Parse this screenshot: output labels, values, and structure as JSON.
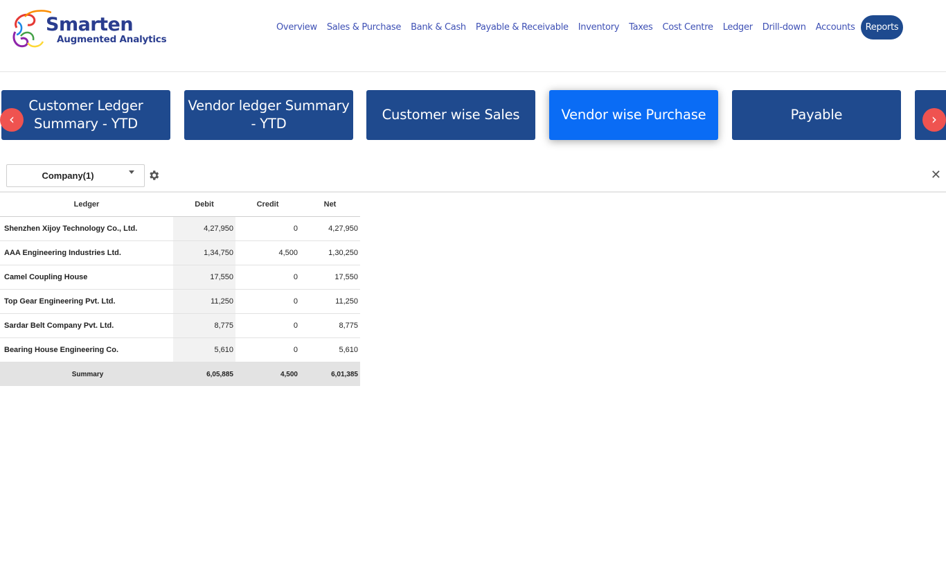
{
  "logo": {
    "title": "Smarten",
    "subtitle": "Augmented Analytics"
  },
  "nav": {
    "items": [
      "Overview",
      "Sales & Purchase",
      "Bank & Cash",
      "Payable & Receivable",
      "Inventory",
      "Taxes",
      "Cost Centre",
      "Ledger",
      "Drill-down",
      "Accounts"
    ],
    "active": "Reports"
  },
  "carousel": {
    "cards": [
      "Customer Ledger Summary - YTD",
      "Vendor ledger Summary - YTD",
      "Customer wise Sales",
      "Vendor wise Purchase",
      "Payable"
    ],
    "active_index": 3,
    "prev_glyph": "‹",
    "next_glyph": "›"
  },
  "filter": {
    "company_label": "Company(1)"
  },
  "table": {
    "columns": [
      "Ledger",
      "Debit",
      "Credit",
      "Net"
    ],
    "rows": [
      [
        "Shenzhen Xijoy Technology Co., Ltd.",
        "4,27,950",
        "0",
        "4,27,950"
      ],
      [
        "AAA Engineering Industries Ltd.",
        "1,34,750",
        "4,500",
        "1,30,250"
      ],
      [
        "Camel Coupling House",
        "17,550",
        "0",
        "17,550"
      ],
      [
        "Top Gear Engineering Pvt. Ltd.",
        "11,250",
        "0",
        "11,250"
      ],
      [
        "Sardar Belt Company Pvt. Ltd.",
        "8,775",
        "0",
        "8,775"
      ],
      [
        "Bearing House Engineering Co.",
        "5,610",
        "0",
        "5,610"
      ]
    ],
    "summary": [
      "Summary",
      "6,05,885",
      "4,500",
      "6,01,385"
    ]
  },
  "colors": {
    "brand": "#1f4a8e",
    "active_card": "#0a6cf5",
    "arrow": "#ef5350",
    "nav_text": "#3f51b5"
  }
}
